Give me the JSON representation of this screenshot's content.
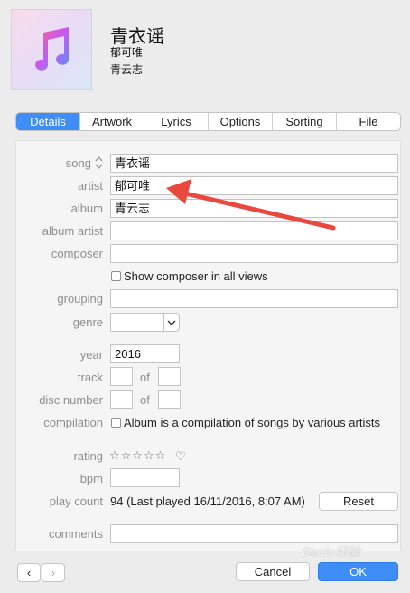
{
  "header": {
    "title": "青衣谣",
    "artist": "郁可唯",
    "album": "青云志",
    "artwork_icon": "music-note-icon"
  },
  "tabs": [
    {
      "label": "Details",
      "active": true
    },
    {
      "label": "Artwork",
      "active": false
    },
    {
      "label": "Lyrics",
      "active": false
    },
    {
      "label": "Options",
      "active": false
    },
    {
      "label": "Sorting",
      "active": false
    },
    {
      "label": "File",
      "active": false
    }
  ],
  "fields": {
    "song": {
      "label": "song",
      "value": "青衣谣"
    },
    "artist": {
      "label": "artist",
      "value": "郁可唯"
    },
    "album": {
      "label": "album",
      "value": "青云志"
    },
    "album_artist": {
      "label": "album artist",
      "value": ""
    },
    "composer": {
      "label": "composer",
      "value": ""
    },
    "show_composer": {
      "label": "Show composer in all views",
      "checked": false
    },
    "grouping": {
      "label": "grouping",
      "value": ""
    },
    "genre": {
      "label": "genre",
      "value": ""
    },
    "year": {
      "label": "year",
      "value": "2016"
    },
    "track": {
      "label": "track",
      "value": "",
      "of_label": "of",
      "of_value": ""
    },
    "disc_number": {
      "label": "disc number",
      "value": "",
      "of_label": "of",
      "of_value": ""
    },
    "compilation": {
      "label": "compilation",
      "text": "Album is a compilation of songs by various artists",
      "checked": false
    },
    "rating": {
      "label": "rating",
      "stars": "☆☆☆☆☆",
      "heart": "♡"
    },
    "bpm": {
      "label": "bpm",
      "value": ""
    },
    "play_count": {
      "label": "play count",
      "value": "94 (Last played 16/11/2016, 8:07 AM)",
      "reset_label": "Reset"
    },
    "comments": {
      "label": "comments",
      "value": ""
    }
  },
  "footer": {
    "prev": "‹",
    "next": "›",
    "cancel": "Cancel",
    "ok": "OK"
  },
  "watermark": "Baidu经验",
  "colors": {
    "accent": "#3f8ef7",
    "annotation_arrow": "#e8483d"
  }
}
